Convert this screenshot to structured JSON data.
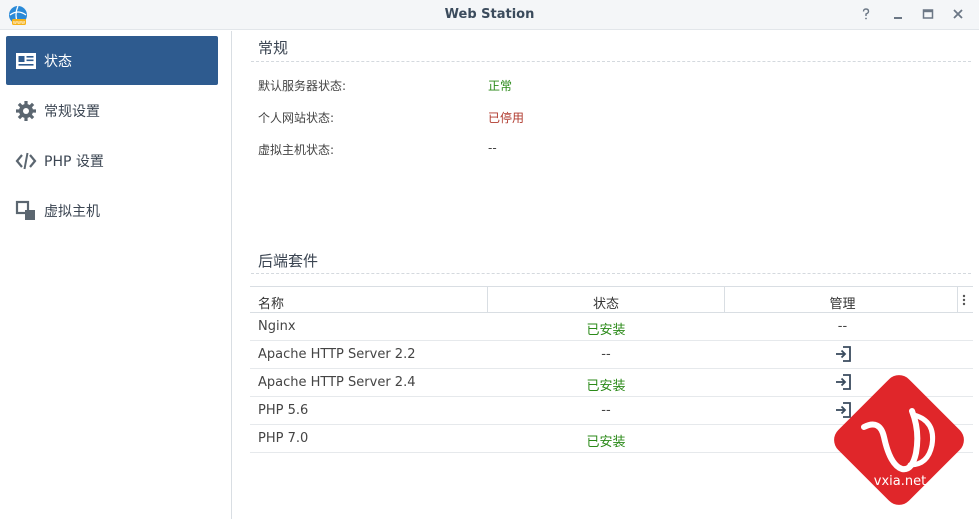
{
  "window": {
    "title": "Web Station",
    "buttons": {
      "help": "help-icon",
      "minimize": "minimize-icon",
      "maximize": "maximize-icon",
      "close": "close-icon"
    }
  },
  "sidebar": {
    "items": [
      {
        "label": "状态",
        "icon": "status-card-icon",
        "active": true
      },
      {
        "label": "常规设置",
        "icon": "gear-icon",
        "active": false
      },
      {
        "label": "PHP 设置",
        "icon": "code-icon",
        "active": false
      },
      {
        "label": "虚拟主机",
        "icon": "virtual-host-icon",
        "active": false
      }
    ]
  },
  "general": {
    "title": "常规",
    "rows": [
      {
        "label": "默认服务器状态:",
        "value": "正常",
        "color": "#2b8a19"
      },
      {
        "label": "个人网站状态:",
        "value": "已停用",
        "color": "#b03a2e"
      },
      {
        "label": "虚拟主机状态:",
        "value": "--",
        "color": "#444444"
      }
    ]
  },
  "backend": {
    "title": "后端套件",
    "columns": [
      "名称",
      "状态",
      "管理"
    ],
    "rows": [
      {
        "name": "Nginx",
        "status": "已安装",
        "installed": true,
        "manage": "--"
      },
      {
        "name": "Apache HTTP Server 2.2",
        "status": "--",
        "installed": false,
        "manage": "open-icon"
      },
      {
        "name": "Apache HTTP Server 2.4",
        "status": "已安装",
        "installed": true,
        "manage": "open-icon"
      },
      {
        "name": "PHP 5.6",
        "status": "--",
        "installed": false,
        "manage": "open-icon"
      },
      {
        "name": "PHP 7.0",
        "status": "已安装",
        "installed": true,
        "manage": "open-icon"
      }
    ]
  },
  "colors": {
    "accent": "#2e5b8f",
    "installed": "#2b8a19",
    "disabled": "#b03a2e",
    "watermark": "#e0262a"
  },
  "watermark": {
    "text": "vxia.net"
  }
}
